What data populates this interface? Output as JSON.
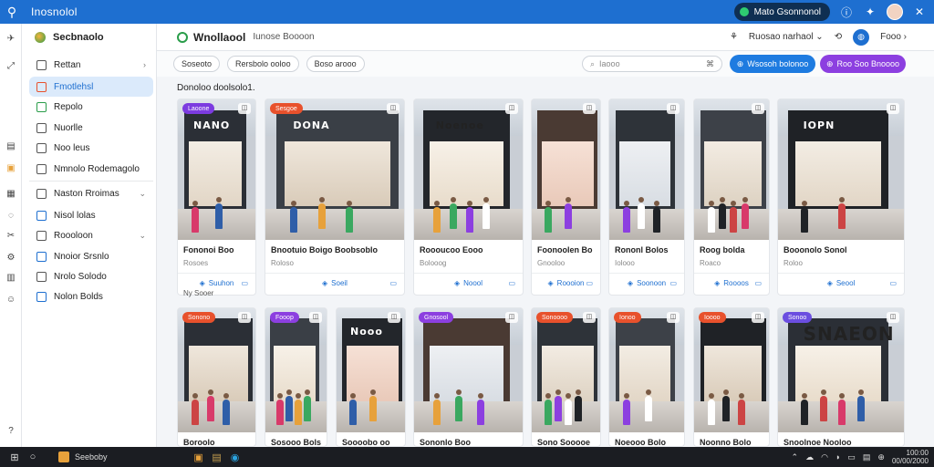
{
  "titlebar": {
    "app_title": "Inosnolol",
    "account_label": "Mato Gsonnonol"
  },
  "sidebar": {
    "header": "Secbnaolo",
    "items": [
      {
        "label": "Rettan",
        "chevron": "›"
      },
      {
        "label": "Fmotlehsl"
      },
      {
        "label": "Repolo"
      },
      {
        "label": "Nuorlle"
      },
      {
        "label": "Noo leus"
      },
      {
        "label": "Nmnolo Rodemagolo"
      },
      {
        "label": "Naston Rroimas",
        "chevron": "⌄"
      },
      {
        "label": "Nisol lolas"
      },
      {
        "label": "Roooloon",
        "chevron": "⌄"
      },
      {
        "label": "Nnoior Srsnlo"
      },
      {
        "label": "Nrolo Solodo"
      },
      {
        "label": "Nolon Bolds"
      }
    ]
  },
  "header": {
    "title": "Wnollaool",
    "subtitle": "Iunose Boooon",
    "user_select": "Ruosao narhaol",
    "account": "Fooo"
  },
  "filters": {
    "chips": [
      "Soseoto",
      "Rersbolo ooloo",
      "Boso arooo"
    ],
    "search_placeholder": "Iaooo",
    "search_shortcut": "⌘",
    "primary_button": "Wsosoh bolonoo",
    "secondary_button": "Roo Soo Bnoooo"
  },
  "section_title": "Donoloo doolsolo1.",
  "cards": [
    {
      "caption": "Fononoi Boo",
      "sub": "Rosoes",
      "action": "Suuhon",
      "tag": "Laoone",
      "tag_color": "#7c3be0",
      "sign": "NANO",
      "extra": "Ny Sooer"
    },
    {
      "caption": "Bnootuio Boigo Boobsoblo",
      "sub": "Roloso",
      "action": "Soeil",
      "tag": "Sesgoe",
      "tag_color": "#e8512c",
      "sign": "DONA"
    },
    {
      "caption": "Roooucoo Eooo",
      "sub": "Bolooog",
      "action": "Noool",
      "tag": "",
      "tag_color": "",
      "sign": "Noenoe"
    },
    {
      "caption": "Foonoolen Bo",
      "sub": "Gnooloo",
      "action": "Roooion",
      "tag": "",
      "tag_color": "",
      "sign": ""
    },
    {
      "caption": "Rononl Bolos",
      "sub": "Iolooo",
      "action": "Soonoon",
      "tag": "",
      "tag_color": "",
      "sign": ""
    },
    {
      "caption": "Roog bolda",
      "sub": "Roaco",
      "action": "Roooos",
      "tag": "",
      "tag_color": "",
      "sign": ""
    },
    {
      "caption": "Booonolo Sonol",
      "sub": "Roloo",
      "action": "Seool",
      "tag": "",
      "tag_color": "",
      "sign": "IOPN"
    },
    {
      "caption": "Boroolo",
      "sub": "",
      "action": "",
      "tag": "Sonono",
      "tag_color": "#e8512c",
      "sign": ""
    },
    {
      "caption": "Sosooo Bols",
      "sub": "",
      "action": "",
      "tag": "Fooop",
      "tag_color": "#8c3fe0",
      "sign": ""
    },
    {
      "caption": "Soooobo oo",
      "sub": "",
      "action": "",
      "tag": "",
      "tag_color": "",
      "sign": "Nooo"
    },
    {
      "caption": "Sononlo Boo",
      "sub": "",
      "action": "",
      "tag": "Gnosool",
      "tag_color": "#8c3fe0",
      "sign": ""
    },
    {
      "caption": "Sono Sooooe",
      "sub": "",
      "action": "",
      "tag": "Sonoooo",
      "tag_color": "#e8512c",
      "sign": ""
    },
    {
      "caption": "Noeooo Bolo",
      "sub": "",
      "action": "",
      "tag": "Ionoo",
      "tag_color": "#e8512c",
      "sign": ""
    },
    {
      "caption": "Noonno Bolo",
      "sub": "",
      "action": "",
      "tag": "Ioooo",
      "tag_color": "#e8512c",
      "sign": ""
    },
    {
      "caption": "Snoolnoe Nooloo",
      "sub": "",
      "action": "",
      "tag": "Sonoo",
      "tag_color": "#6b4ee0",
      "sign": "SNAEON"
    }
  ],
  "taskbar": {
    "app_label": "Seeboby",
    "time": "100:00",
    "date": "00/00/2000"
  }
}
